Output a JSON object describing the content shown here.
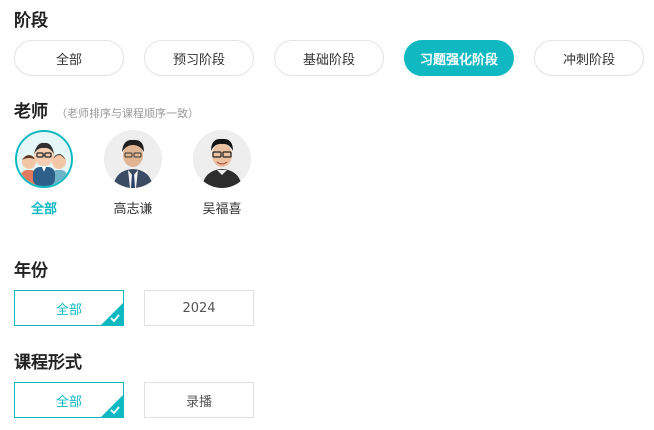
{
  "stage": {
    "title": "阶段",
    "options": [
      "全部",
      "预习阶段",
      "基础阶段",
      "习题强化阶段",
      "冲刺阶段"
    ],
    "selected": "习题强化阶段"
  },
  "teacher": {
    "title": "老师",
    "note": "（老师排序与课程顺序一致）",
    "items": [
      {
        "name": "全部",
        "icon": "group-avatar-icon"
      },
      {
        "name": "高志谦",
        "icon": "teacher-photo"
      },
      {
        "name": "吴福喜",
        "icon": "teacher-photo"
      }
    ],
    "selected": "全部"
  },
  "year": {
    "title": "年份",
    "options": [
      "全部",
      "2024"
    ],
    "selected": "全部"
  },
  "format": {
    "title": "课程形式",
    "options": [
      "全部",
      "录播"
    ],
    "selected": "全部"
  },
  "colors": {
    "accent": "#10b9c2"
  }
}
